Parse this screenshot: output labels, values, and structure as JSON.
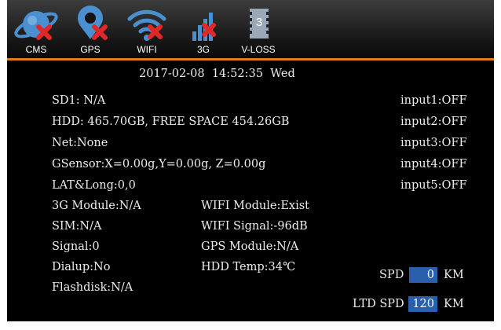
{
  "status_bar": {
    "items": [
      {
        "label": "CMS",
        "icon": "satellite-icon",
        "error": true
      },
      {
        "label": "GPS",
        "icon": "location-pin-icon",
        "error": true
      },
      {
        "label": "WIFI",
        "icon": "wifi-icon",
        "error": true
      },
      {
        "label": "3G",
        "icon": "signal-bars-icon",
        "error": true
      },
      {
        "label": "V-LOSS",
        "icon": "video-loss-icon",
        "badge": "3"
      }
    ],
    "colors": {
      "icon": "#4a90d0",
      "error_mark": "#e12828",
      "divider": "#e37c1c"
    }
  },
  "datetime": {
    "text": "2017-02-08  14:52:35  Wed"
  },
  "left_info": [
    "SD1: N/A",
    "HDD: 465.70GB, FREE SPACE 454.26GB",
    "Net:None",
    "GSensor:X=0.00g,Y=0.00g, Z=0.00g",
    "LAT&Long:0,0",
    "3G Module:N/A",
    "SIM:N/A",
    "Signal:0",
    "Dialup:No",
    "Flashdisk:N/A"
  ],
  "middle_info": [
    "WIFI Module:Exist",
    "WIFI Signal:-96dB",
    "GPS Module:N/A",
    "HDD Temp:34℃"
  ],
  "inputs": [
    "input1:OFF",
    "input2:OFF",
    "input3:OFF",
    "input4:OFF",
    "input5:OFF"
  ],
  "speed": {
    "spd_label": "SPD",
    "spd_value": "0",
    "spd_unit": "KM",
    "ltd_label": "LTD SPD",
    "ltd_value": "120",
    "ltd_unit": "KM",
    "value_color": "#2b5eab"
  }
}
